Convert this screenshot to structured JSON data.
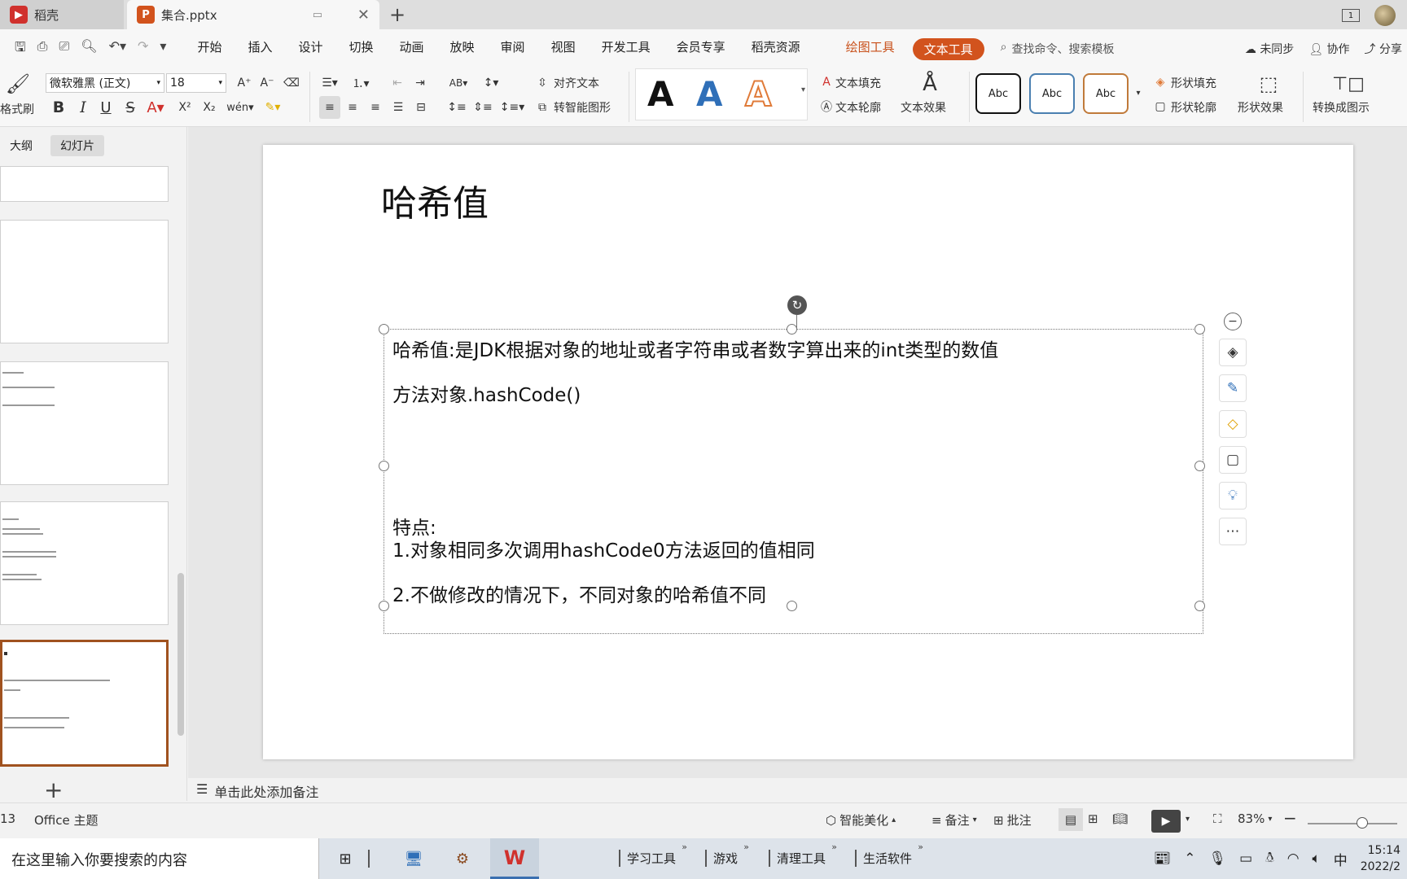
{
  "titlebar": {
    "app_tab": "稻壳",
    "doc_tab": "集合.pptx",
    "new_tab": "+",
    "window_count": "1"
  },
  "menubar": {
    "items": [
      "开始",
      "插入",
      "设计",
      "切换",
      "动画",
      "放映",
      "审阅",
      "视图",
      "开发工具",
      "会员专享",
      "稻壳资源"
    ],
    "drawing_tool": "绘图工具",
    "text_tool": "文本工具",
    "search_placeholder": "查找命令、搜索模板",
    "sync": "未同步",
    "collab": "协作",
    "share": "分享"
  },
  "ribbon": {
    "format_painter": "格式刷",
    "font_name": "微软雅黑 (正文)",
    "font_size": "18",
    "align_text": "对齐文本",
    "convert_smartart": "转智能图形",
    "text_fill": "文本填充",
    "text_outline": "文本轮廓",
    "text_effect": "文本效果",
    "wordart_letter": "A",
    "style_abc": "Abc",
    "shape_fill": "形状填充",
    "shape_outline": "形状轮廓",
    "shape_effect": "形状效果",
    "convert_diagram": "转换成图示",
    "colors": {
      "accent": "#d2531d",
      "wordart_blue": "#2f6fb8",
      "wordart_orange": "#e07b39"
    }
  },
  "leftpanel": {
    "tab_outline": "大纲",
    "tab_slides": "幻灯片",
    "add_slide": "+"
  },
  "slide": {
    "title": "哈希值",
    "lines": [
      "哈希值:是JDK根据对象的地址或者字符串或者数字算出来的int类型的数值",
      "方法对象.hashCode()",
      "特点:",
      "1.对象相同多次调用hashCode0方法返回的值相同",
      "2.不做修改的情况下，不同对象的哈希值不同"
    ]
  },
  "notes": {
    "placeholder": "单击此处添加备注"
  },
  "statusbar": {
    "slide_count": "13",
    "theme": "Office 主题",
    "smart_beautify": "智能美化",
    "notes": "备注",
    "comments": "批注",
    "zoom": "83%"
  },
  "taskbar": {
    "search_placeholder": "在这里输入你要搜索的内容",
    "groups": [
      "学习工具",
      "游戏",
      "清理工具",
      "生活软件"
    ],
    "ime": "中",
    "time": "15:14",
    "date": "2022/2"
  }
}
